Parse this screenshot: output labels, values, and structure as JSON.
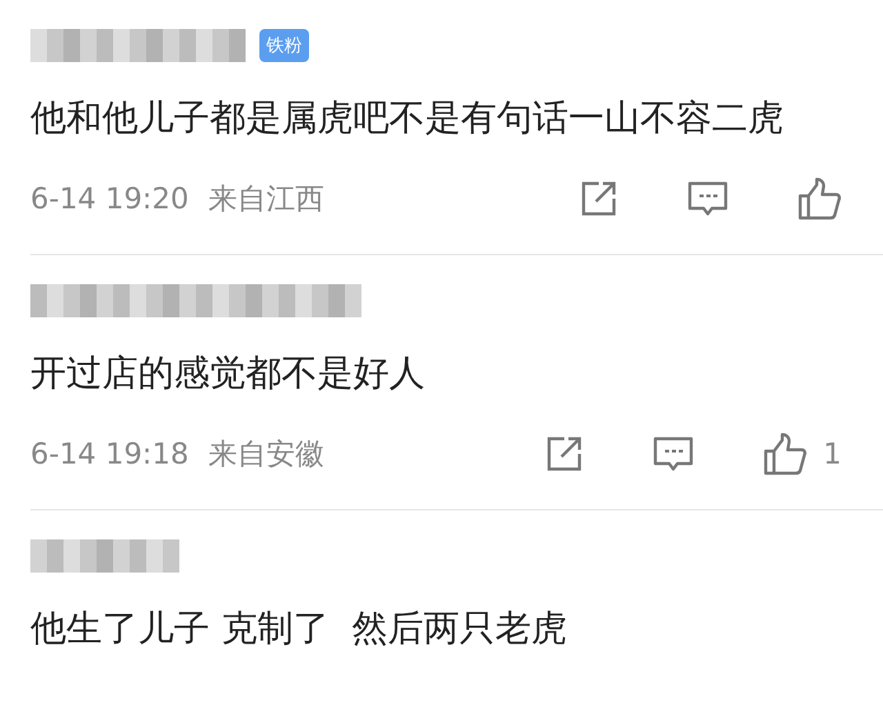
{
  "comments": [
    {
      "badge": "铁粉",
      "text": "他和他儿子都是属虎吧不是有句话一山不容二虎",
      "time": "6-14 19:20",
      "location": "来自江西"
    },
    {
      "text": "开过店的感觉都不是好人",
      "time": "6-14 19:18",
      "location": "来自安徽",
      "likes": "1"
    },
    {
      "text": "他生了儿子 克制了  然后两只老虎"
    }
  ]
}
